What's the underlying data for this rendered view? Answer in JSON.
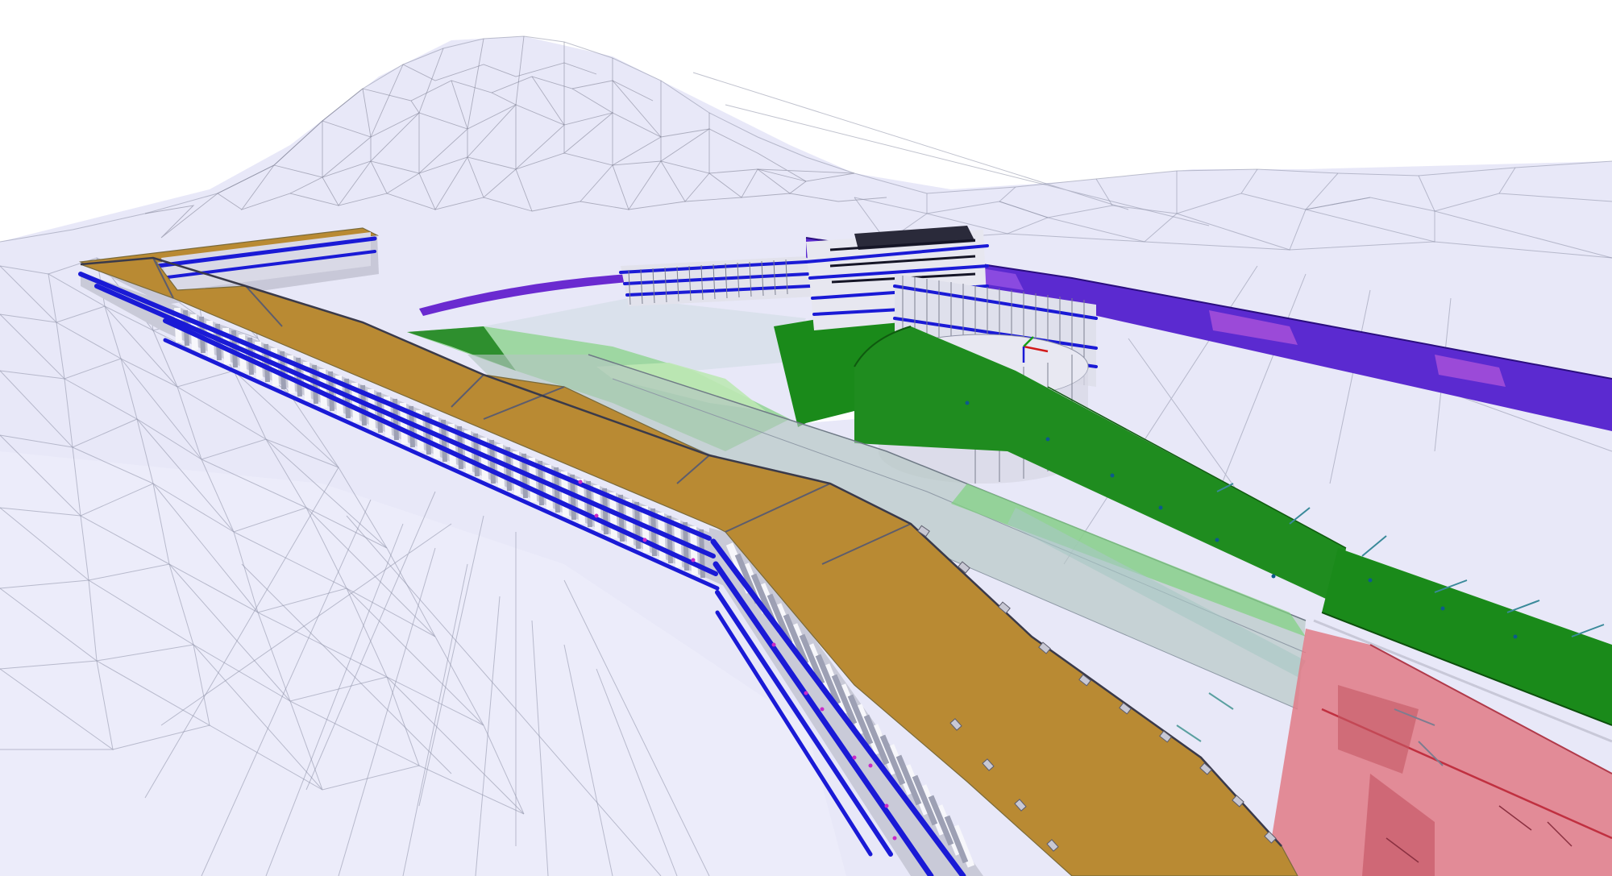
{
  "colors": {
    "background": "#ffffff",
    "terrain_fill": "#e8e8f8",
    "terrain_mesh": "#8d8fa6",
    "deck": "#b98a33",
    "retaining_wall_green": "#1a8a1a",
    "wall_green_light": "#5cc25c",
    "pile_white": "#f2f2f5",
    "pile_grey": "#a9acbb",
    "anchor_blue": "#1a1ad6",
    "roadway_purple": "#5b2ad0",
    "tunnel_red": "#e07a86",
    "translucent_grey": "#b4c6c2"
  },
  "scene": {
    "components": [
      "terrain-mesh",
      "hill-mesh",
      "main-deck",
      "rear-deck",
      "front-pile-wall",
      "upper-pile-wall",
      "right-pile-wall",
      "green-retaining-wall",
      "green-floor",
      "translucent-ramp",
      "purple-roadway",
      "red-tunnel-structure",
      "axis-gizmo"
    ]
  }
}
